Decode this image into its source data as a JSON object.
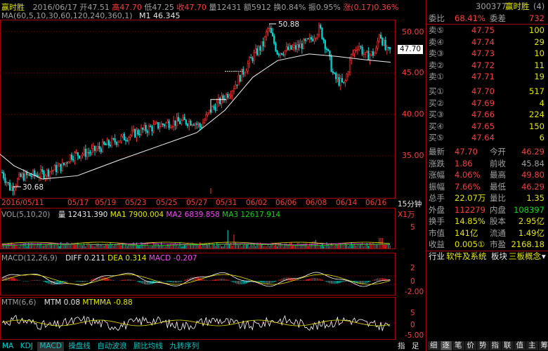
{
  "header": {
    "stock_name": "赢时胜",
    "date": "2016/06/17",
    "open": "开47.51",
    "high": "高47.70",
    "low": "低47.25",
    "close": "收47.70",
    "volume": "量12431",
    "amount": "额5912",
    "turnover": "换0.84%",
    "amplitude": "振0.95%",
    "change": "涨(0.17)0.36%"
  },
  "ma_legend": {
    "label": "MA(60,5,10,30,60,120,240,360,1)",
    "m1": "M1 46.345"
  },
  "price_axis": {
    "ticks": [
      "50.00",
      "45.00",
      "40.00",
      "35.00"
    ],
    "current": "47.70"
  },
  "annotations": {
    "high": "50.88",
    "low": "30.68"
  },
  "date_axis": {
    "labels": [
      "2016/05/11",
      "05/17",
      "05/19",
      "05/23",
      "05/25",
      "05/27",
      "05/31",
      "06/02",
      "06/06",
      "06/08",
      "06/14",
      "06/16"
    ],
    "period": "15分钟"
  },
  "vol_panel": {
    "label": "VOL(5,10,20)",
    "qty": "量 12431.390",
    "ma1": "MA1 7900.004",
    "ma2": "MA2 6839.858",
    "ma3": "MA3 12617.914",
    "unit": "X1万",
    "ticks": [
      "5"
    ]
  },
  "macd_panel": {
    "label": "MACD(12,26,9)",
    "diff": "DIFF 0.211",
    "dea": "DEA 0.314",
    "macd": "MACD -0.207",
    "ticks": [
      "2",
      "0",
      "-2.00"
    ]
  },
  "mtm_panel": {
    "label": "MTM(6,6)",
    "mtm": "MTM 0.08",
    "mtmma": "MTMMA -0.88",
    "ticks": [
      "5",
      "0",
      "-5.00"
    ]
  },
  "bottom_tabs": [
    "MA",
    "KDJ",
    "MACD",
    "操盘线",
    "自动波浪",
    "顾比均线",
    "九转序列"
  ],
  "bottom_right": [
    "指",
    "足"
  ],
  "quote": {
    "code": "300377",
    "name": "赢时胜",
    "count": "(4)",
    "wei_bi_label": "委比",
    "wei_bi": "68.41%",
    "wei_cha_label": "委差",
    "wei_cha": "732",
    "asks": [
      {
        "label": "卖⑤",
        "price": "47.75",
        "qty": "100"
      },
      {
        "label": "卖④",
        "price": "47.74",
        "qty": "29"
      },
      {
        "label": "卖③",
        "price": "47.73",
        "qty": "10"
      },
      {
        "label": "卖②",
        "price": "47.72",
        "qty": "11"
      },
      {
        "label": "卖①",
        "price": "47.71",
        "qty": "19"
      }
    ],
    "bids": [
      {
        "label": "买①",
        "price": "47.70",
        "qty": "517"
      },
      {
        "label": "买②",
        "price": "47.69",
        "qty": "4"
      },
      {
        "label": "买③",
        "price": "47.66",
        "qty": "224"
      },
      {
        "label": "买④",
        "price": "47.65",
        "qty": "150"
      },
      {
        "label": "买⑤",
        "price": "47.64",
        "qty": "6"
      }
    ],
    "stats": [
      {
        "l1": "最新",
        "v1": "47.70",
        "l2": "今开",
        "v2": "46.29"
      },
      {
        "l1": "涨跌",
        "v1": "1.86",
        "l2": "前收",
        "v2": "45.84"
      },
      {
        "l1": "涨幅",
        "v1": "4.06%",
        "l2": "最高",
        "v2": "49.80"
      },
      {
        "l1": "振幅",
        "v1": "7.66%",
        "l2": "最低",
        "v2": "46.29"
      },
      {
        "l1": "总手",
        "v1": "22.07万",
        "l2": "量比",
        "v2": "1.35"
      },
      {
        "l1": "外盘",
        "v1": "112279",
        "l2": "内盘",
        "v2": "108397"
      }
    ],
    "stats2": [
      {
        "l1": "换手",
        "v1": "14.85%",
        "l2": "股本",
        "v2": "2.95亿"
      },
      {
        "l1": "市值",
        "v1": "141亿",
        "l2": "流通",
        "v2": "1.49亿"
      },
      {
        "l1": "收益",
        "v1": "0.005①",
        "l2": "市盈",
        "v2": "2168.18"
      }
    ],
    "industry_label": "行业",
    "industry": "软件及系统",
    "sector_label": "板块",
    "sector": "三板概念",
    "bottom_icons": [
      "细",
      "逐",
      "笔",
      "价",
      "势",
      "指",
      "联",
      "值",
      "主",
      "筹"
    ]
  }
}
